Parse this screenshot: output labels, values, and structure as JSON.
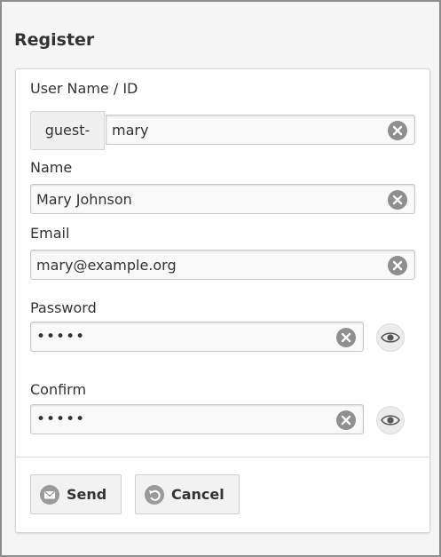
{
  "form": {
    "title": "Register",
    "fields": {
      "username": {
        "label": "User Name / ID",
        "prefix": "guest-",
        "value": "mary"
      },
      "name": {
        "label": "Name",
        "value": "Mary Johnson"
      },
      "email": {
        "label": "Email",
        "value": "mary@example.org"
      },
      "password": {
        "label": "Password",
        "value": "•••••"
      },
      "confirm": {
        "label": "Confirm",
        "value": "•••••"
      }
    },
    "buttons": {
      "send": {
        "label": "Send",
        "icon": "envelope-icon"
      },
      "cancel": {
        "label": "Cancel",
        "icon": "undo-icon"
      }
    }
  },
  "colors": {
    "panel_border": "#d6d6d6",
    "clear_icon": "#8f8f8f",
    "button_bg": "#f2f2f2"
  }
}
